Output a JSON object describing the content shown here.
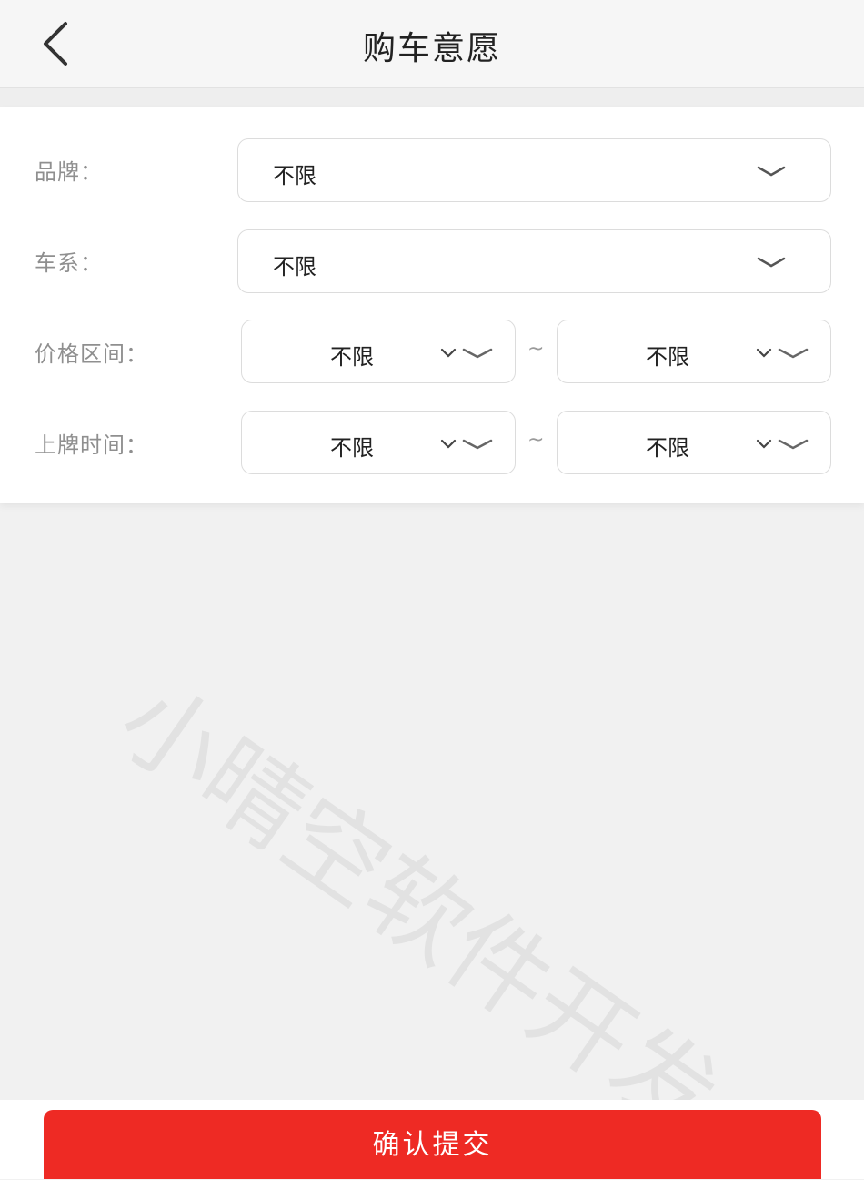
{
  "header": {
    "title": "购车意愿",
    "back_icon": "chevron-left-icon"
  },
  "form": {
    "brand": {
      "label": "品牌：",
      "value": "不限"
    },
    "series": {
      "label": "车系：",
      "value": "不限"
    },
    "price_range": {
      "label": "价格区间：",
      "from": "不限",
      "separator": "~",
      "to": "不限"
    },
    "plate_time": {
      "label": "上牌时间：",
      "from": "不限",
      "separator": "~",
      "to": "不限"
    }
  },
  "watermark": "小晴空软件开发",
  "submit": {
    "label": "确认提交"
  },
  "colors": {
    "accent": "#ee2a24",
    "background": "#f1f1f1",
    "card": "#ffffff"
  }
}
